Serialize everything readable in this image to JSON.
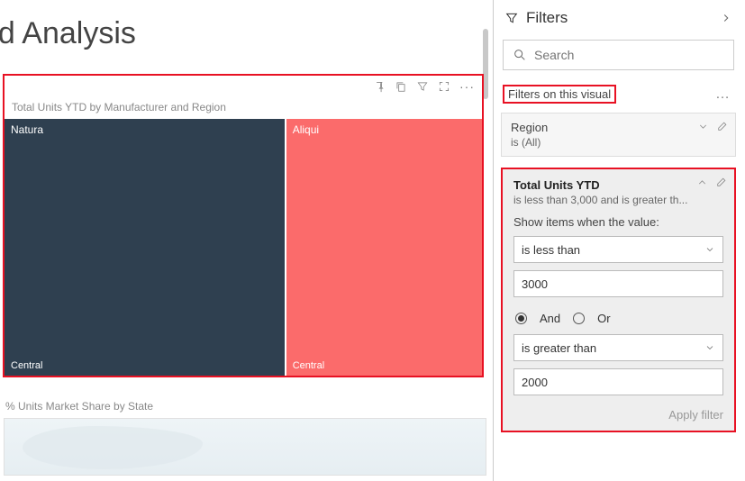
{
  "page": {
    "title": "end Analysis"
  },
  "visual": {
    "title": "Total Units YTD by Manufacturer and Region",
    "cells": [
      {
        "name": "Natura",
        "region": "Central"
      },
      {
        "name": "Aliqui",
        "region": "Central"
      }
    ]
  },
  "sub_visual": {
    "title": "% Units Market Share by State"
  },
  "filters": {
    "pane_title": "Filters",
    "search_placeholder": "Search",
    "section_label": "Filters on this visual",
    "region_card": {
      "title": "Region",
      "desc": "is (All)"
    },
    "total_units": {
      "title": "Total Units YTD",
      "desc": "is less than 3,000 and is greater th...",
      "show_label": "Show items when the value:",
      "op1": "is less than",
      "val1": "3000",
      "logic_and": "And",
      "logic_or": "Or",
      "logic_selected": "and",
      "op2": "is greater than",
      "val2": "2000",
      "apply": "Apply filter"
    }
  },
  "chart_data": {
    "type": "treemap",
    "title": "Total Units YTD by Manufacturer and Region",
    "series": [
      {
        "name": "Natura",
        "region": "Central",
        "approx_share": 0.59
      },
      {
        "name": "Aliqui",
        "region": "Central",
        "approx_share": 0.41
      }
    ],
    "note": "Values are filtered to Total Units YTD between 2000 and 3000; exact values not labeled on chart, proportions estimated from area."
  }
}
